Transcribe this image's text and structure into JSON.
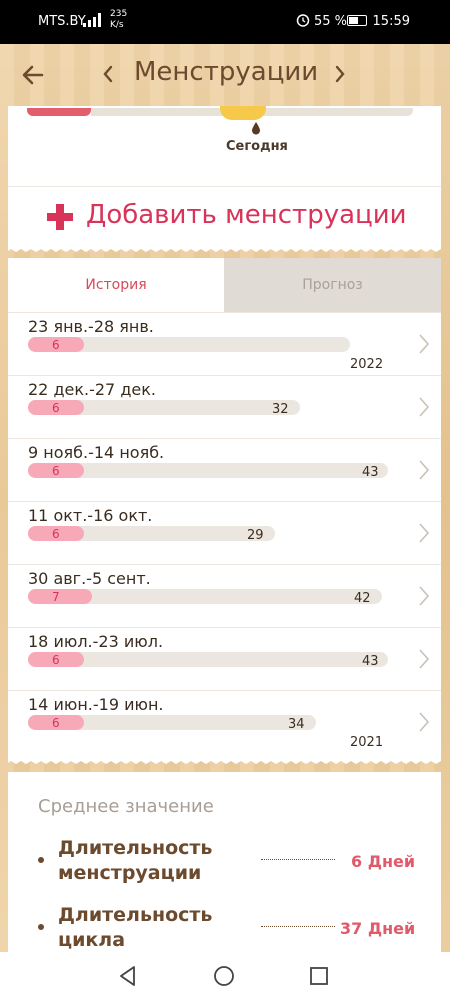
{
  "status": {
    "carrier": "MTS.BY",
    "speed": "235",
    "speed_unit": "K/s",
    "battery": "55 %",
    "time": "15:59"
  },
  "header": {
    "title": "Менструации"
  },
  "top": {
    "today_label": "Сегодня",
    "add_label": "Добавить менструации"
  },
  "tabs": {
    "history": "История",
    "forecast": "Прогноз"
  },
  "history": [
    {
      "dates": "23 янв.-28 янв.",
      "period": "6",
      "cycle": "",
      "year": "2022"
    },
    {
      "dates": "22 дек.-27 дек.",
      "period": "6",
      "cycle": "32",
      "year": ""
    },
    {
      "dates": "9 нояб.-14 нояб.",
      "period": "6",
      "cycle": "43",
      "year": ""
    },
    {
      "dates": "11 окт.-16 окт.",
      "period": "6",
      "cycle": "29",
      "year": ""
    },
    {
      "dates": "30 авг.-5 сент.",
      "period": "7",
      "cycle": "42",
      "year": ""
    },
    {
      "dates": "18 июл.-23 июл.",
      "period": "6",
      "cycle": "43",
      "year": ""
    },
    {
      "dates": "14 июн.-19 июн.",
      "period": "6",
      "cycle": "34",
      "year": "2021"
    }
  ],
  "average": {
    "title": "Среднее значение",
    "period_label_1": "Длительность",
    "period_label_2": "менструации",
    "period_value": "6 Дней",
    "cycle_label_1": "Длительность",
    "cycle_label_2": "цикла",
    "cycle_value": "37 Дней"
  },
  "colors": {
    "accent": "#d8345a",
    "period_fill": "#f7a9b8",
    "brown": "#6b4a2e"
  }
}
